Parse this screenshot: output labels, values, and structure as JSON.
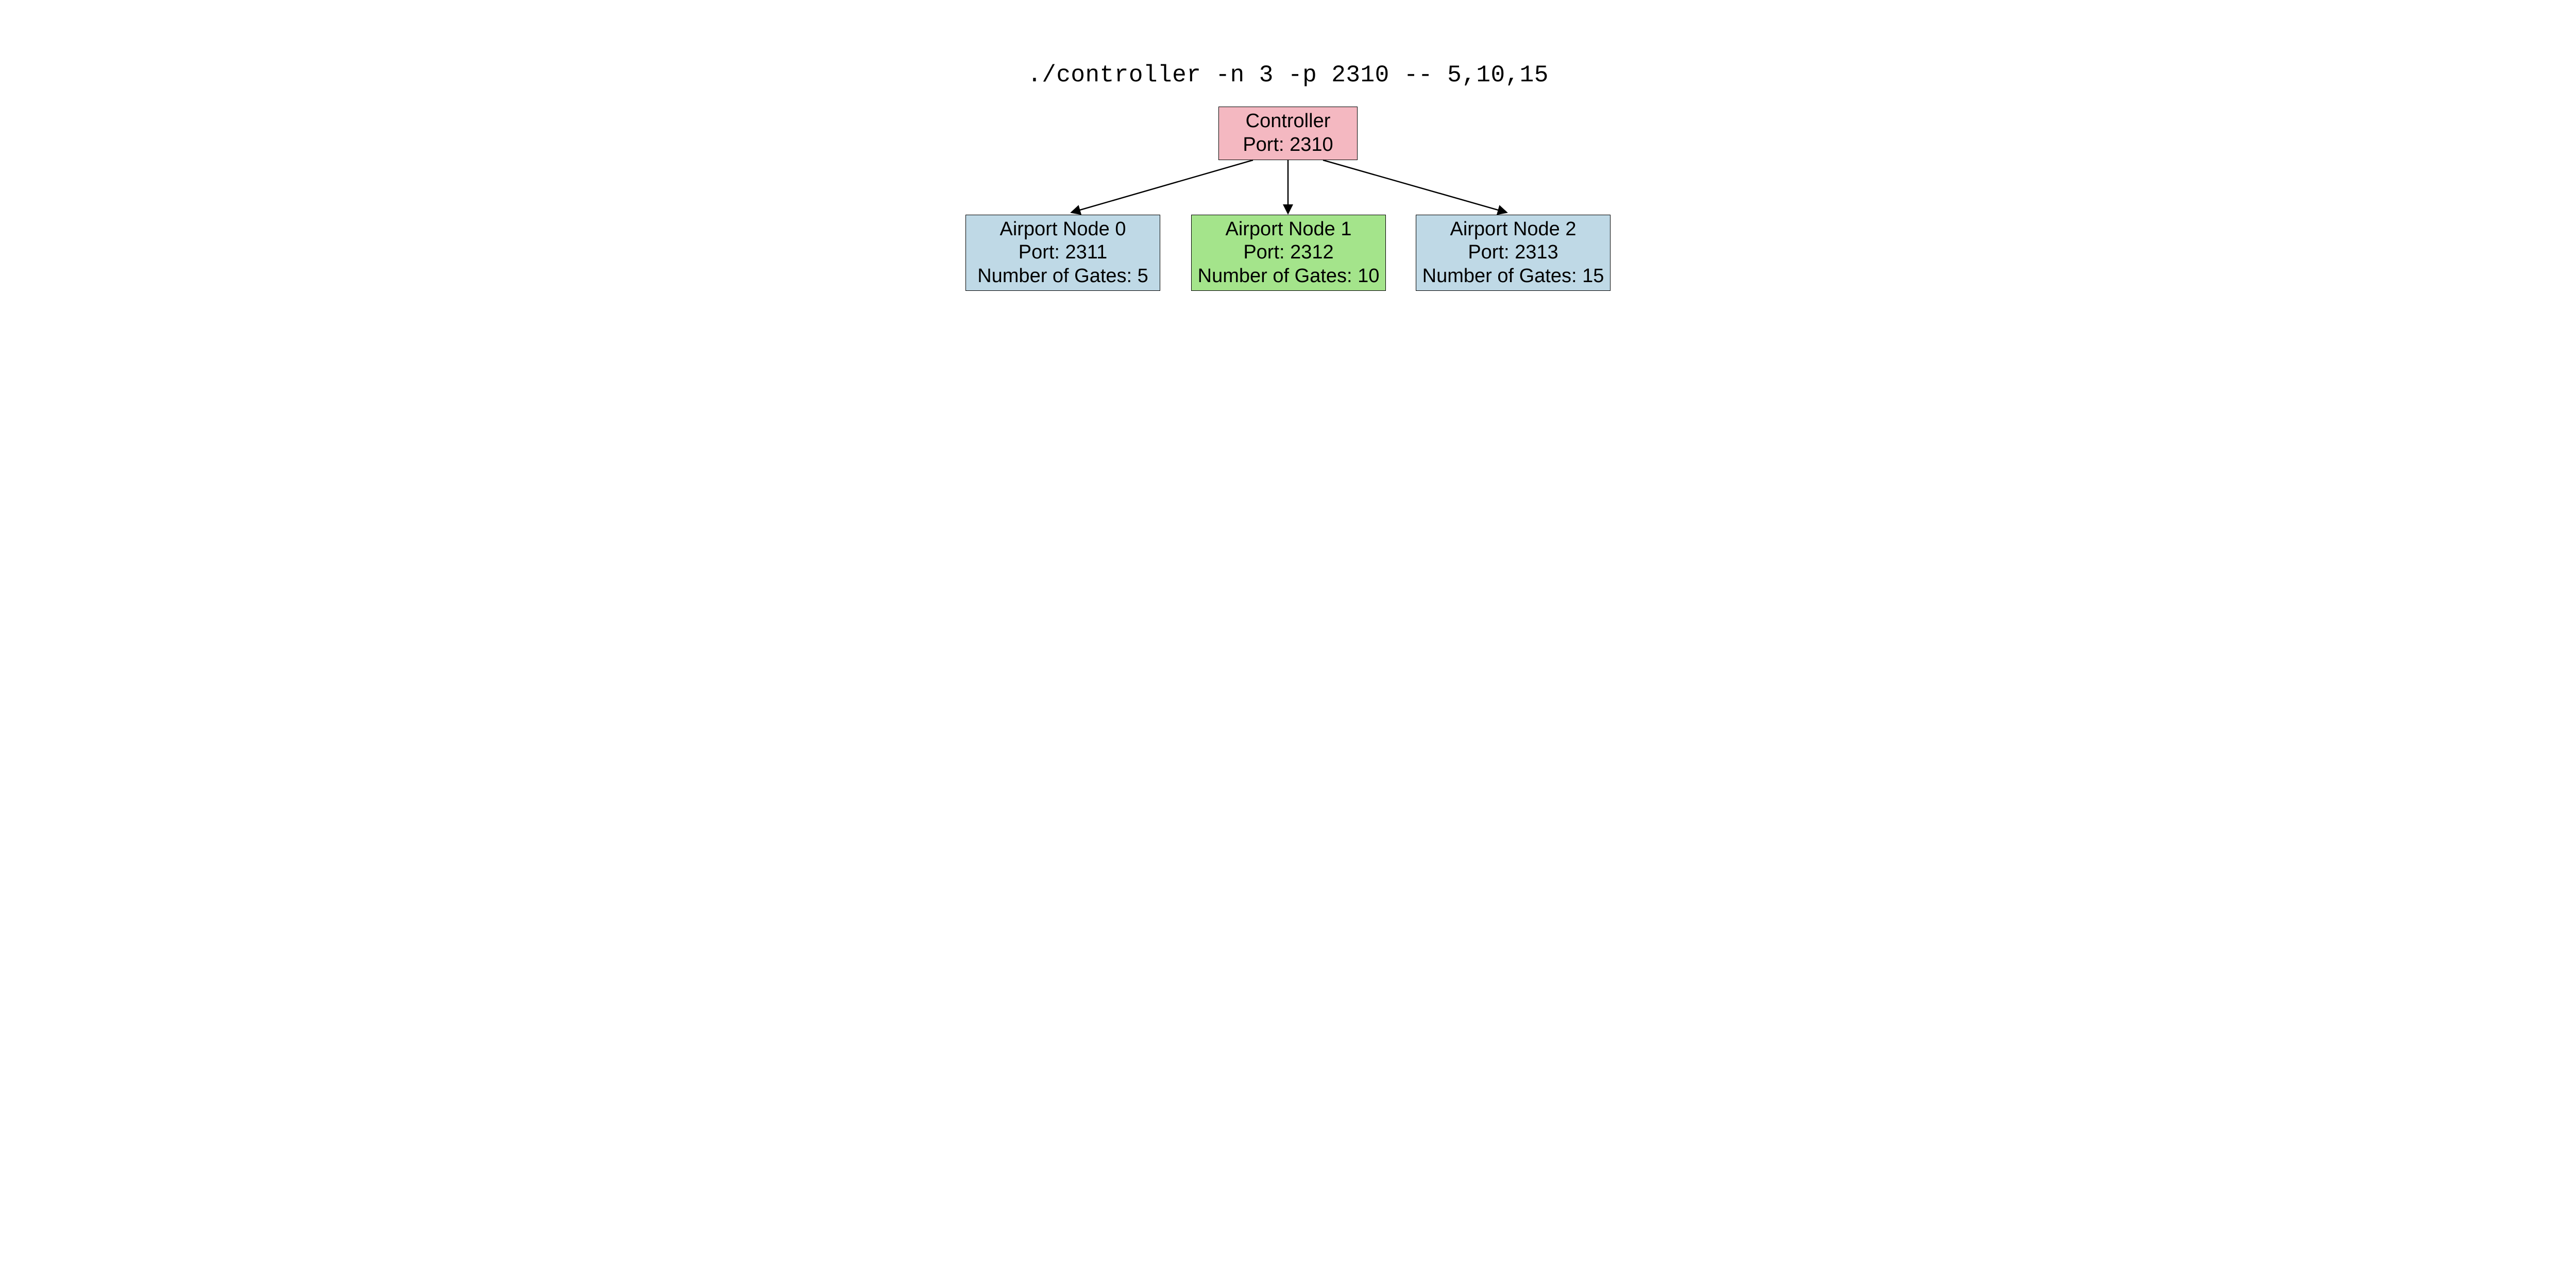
{
  "command": "./controller -n 3 -p 2310 -- 5,10,15",
  "controller": {
    "title": "Controller",
    "port_label": "Port: 2310"
  },
  "airports": [
    {
      "title": "Airport Node 0",
      "port_label": "Port: 2311",
      "gates_label": "Number of Gates: 5"
    },
    {
      "title": "Airport Node 1",
      "port_label": "Port: 2312",
      "gates_label": "Number of Gates: 10"
    },
    {
      "title": "Airport Node 2",
      "port_label": "Port: 2313",
      "gates_label": "Number of Gates: 15"
    }
  ],
  "colors": {
    "controller_bg": "#F4B8C1",
    "airport_blue_bg": "#BFD9E6",
    "airport_green_bg": "#A4E48B"
  }
}
